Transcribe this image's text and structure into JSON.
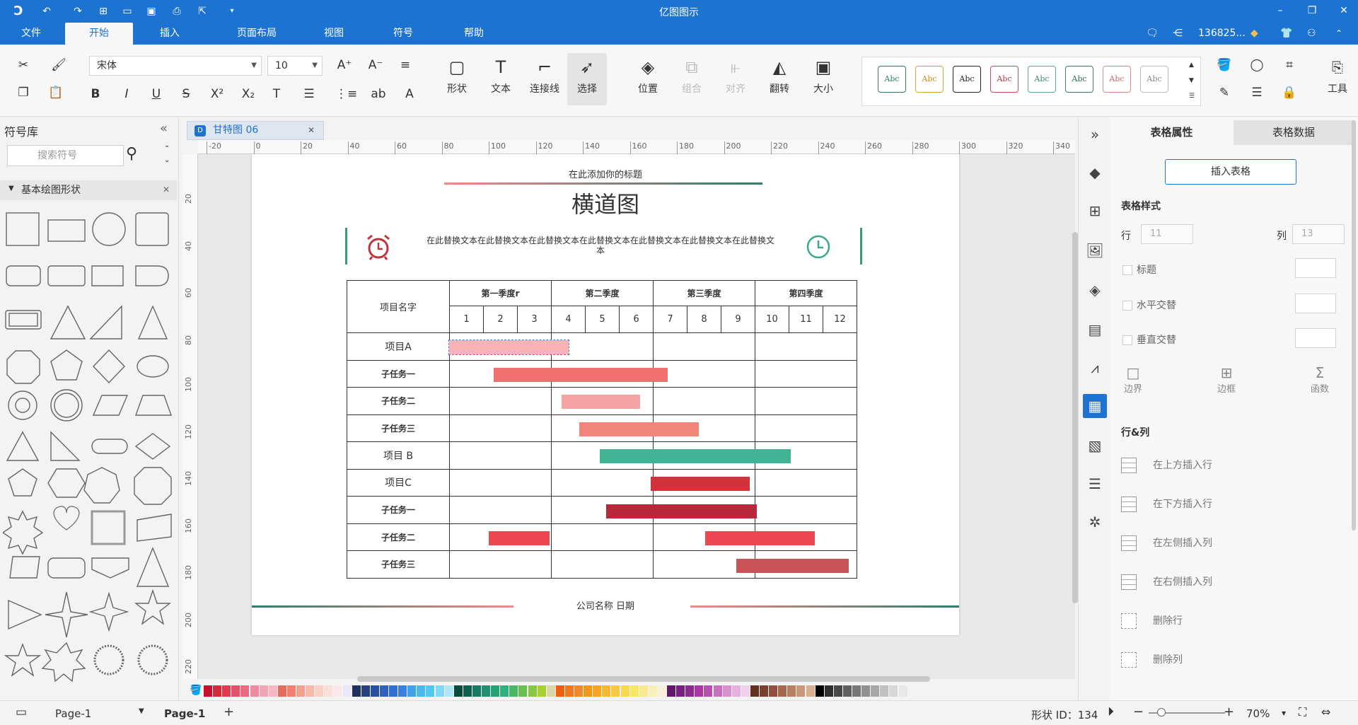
{
  "app": {
    "title": "亿图图示"
  },
  "menu": {
    "items": [
      "文件",
      "开始",
      "插入",
      "页面布局",
      "视图",
      "符号",
      "帮助"
    ],
    "user": "136825..."
  },
  "ribbon": {
    "font_name": "宋体",
    "font_size": "10",
    "tools": [
      "形状",
      "文本",
      "连接线",
      "选择",
      "位置",
      "组合",
      "对齐",
      "翻转",
      "大小"
    ],
    "tools_label": "工具",
    "style_label": "Abc"
  },
  "left_panel": {
    "title": "符号库",
    "search_placeholder": "搜索符号",
    "category": "基本绘图形状"
  },
  "document": {
    "tab": "甘特图 06"
  },
  "ruler": {
    "h": [
      "-20",
      "0",
      "20",
      "40",
      "60",
      "80",
      "100",
      "120",
      "140",
      "160",
      "180",
      "200",
      "220",
      "240",
      "260",
      "280",
      "300",
      "320",
      "340"
    ],
    "v": [
      "20",
      "40",
      "60",
      "80",
      "100",
      "120",
      "140",
      "160",
      "180",
      "200",
      "220"
    ]
  },
  "diagram": {
    "subtitle": "在此添加你的标题",
    "title": "横道图",
    "description": "在此替换文本在此替换文本在此替换文本在此替换文本在此替换文本在此替换文本在此替换文本",
    "footer": "公司名称  日期",
    "header_name": "项目名字",
    "quarters": [
      "第一季度r",
      "第二季度",
      "第三季度",
      "第四季度"
    ],
    "months": [
      "1",
      "2",
      "3",
      "4",
      "5",
      "6",
      "7",
      "8",
      "9",
      "10",
      "11",
      "12"
    ],
    "rows": [
      "项目A",
      "子任务一",
      "子任务二",
      "子任务三",
      "项目 B",
      "项目C",
      "子任务一",
      "子任务二",
      "子任务三"
    ],
    "bars": [
      {
        "row": 0,
        "start": 1.0,
        "end": 4.5,
        "color": "#f8b4b4"
      },
      {
        "row": 1,
        "start": 2.3,
        "end": 7.4,
        "color": "#f07070"
      },
      {
        "row": 2,
        "start": 4.3,
        "end": 6.6,
        "color": "#f5a3a3"
      },
      {
        "row": 3,
        "start": 4.8,
        "end": 8.3,
        "color": "#f2857a"
      },
      {
        "row": 4,
        "start": 5.4,
        "end": 11.0,
        "color": "#40b494"
      },
      {
        "row": 5,
        "start": 6.9,
        "end": 9.8,
        "color": "#d2323c"
      },
      {
        "row": 6,
        "start": 5.6,
        "end": 10.0,
        "color": "#b8283a"
      },
      {
        "row": 7,
        "start": 2.15,
        "end": 3.95,
        "color": "#ec4650"
      },
      {
        "row": 7,
        "start": 8.5,
        "end": 11.7,
        "color": "#ec4650"
      },
      {
        "row": 8,
        "start": 9.4,
        "end": 12.7,
        "color": "#c8545a"
      }
    ]
  },
  "right_panel": {
    "tabs": [
      "表格属性",
      "表格数据"
    ],
    "insert_button": "插入表格",
    "table_style": "表格样式",
    "row_label": "行",
    "row_value": "11",
    "col_label": "列",
    "col_value": "13",
    "title_check": "标题",
    "hcross": "水平交替",
    "vcross": "垂直交替",
    "edge": "边界",
    "frame": "边框",
    "func": "函数",
    "rowcol": "行&列",
    "actions": [
      "在上方插入行",
      "在下方插入行",
      "在左侧插入列",
      "在右侧插入列",
      "删除行",
      "删除列"
    ]
  },
  "status": {
    "page_select": "Page-1",
    "page_tab": "Page-1",
    "shape_id": "形状 ID：134",
    "zoom": "70%"
  }
}
